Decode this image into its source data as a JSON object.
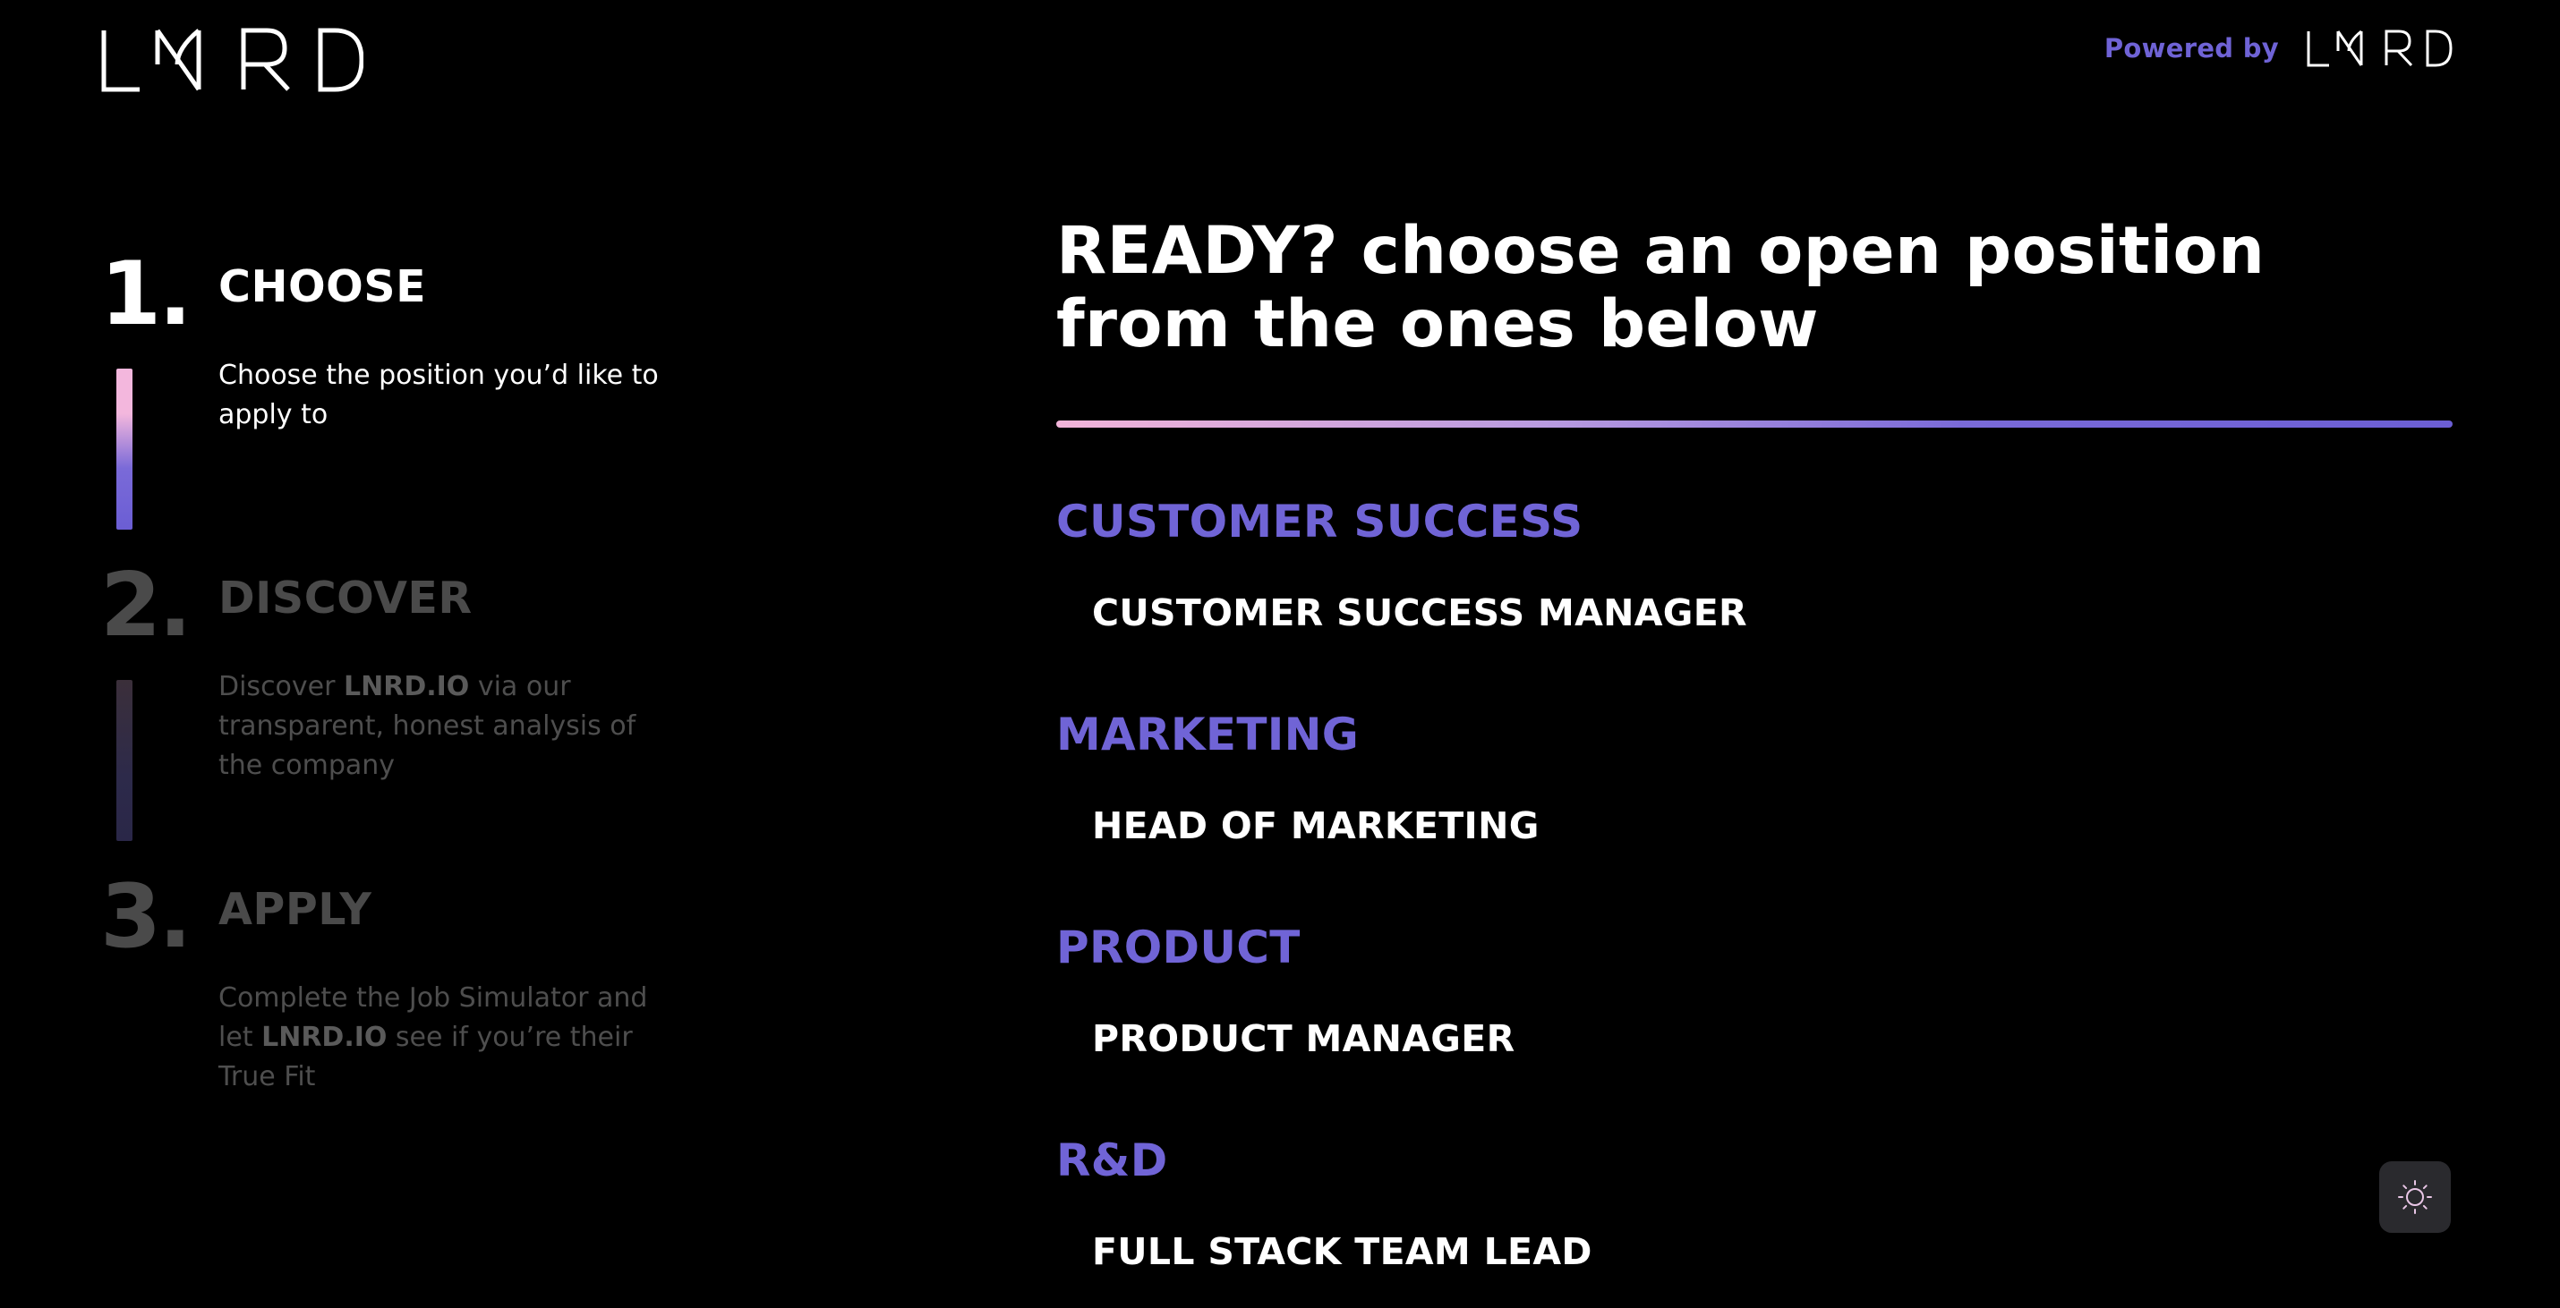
{
  "header": {
    "logo_text": "LNRD",
    "powered_by_label": "Powered by",
    "powered_logo_text": "LNRD"
  },
  "steps": [
    {
      "number": "1.",
      "title": "CHOOSE",
      "desc_before": "Choose the position you’d like to apply to",
      "desc_bold": "",
      "desc_after": "",
      "state": "active"
    },
    {
      "number": "2.",
      "title": "DISCOVER",
      "desc_before": "Discover ",
      "desc_bold": "LNRD.IO",
      "desc_after": " via our transparent, honest analysis of the company",
      "state": "inactive"
    },
    {
      "number": "3.",
      "title": "APPLY",
      "desc_before": "Complete the Job Simulator and let ",
      "desc_bold": "LNRD.IO",
      "desc_after": " see if you’re their True Fit",
      "state": "inactive"
    }
  ],
  "main": {
    "headline": "READY? choose an open position from the ones below",
    "departments": [
      {
        "name": "CUSTOMER SUCCESS",
        "positions": [
          "CUSTOMER SUCCESS MANAGER"
        ]
      },
      {
        "name": "MARKETING",
        "positions": [
          "HEAD OF MARKETING"
        ]
      },
      {
        "name": "PRODUCT",
        "positions": [
          "PRODUCT MANAGER"
        ]
      },
      {
        "name": "R&D",
        "positions": [
          "FULL STACK TEAM LEAD"
        ]
      }
    ]
  },
  "theme_toggle": {
    "icon": "sun-icon"
  },
  "colors": {
    "accent": "#7064d6",
    "pink": "#f3b7dd",
    "background": "#000000"
  }
}
